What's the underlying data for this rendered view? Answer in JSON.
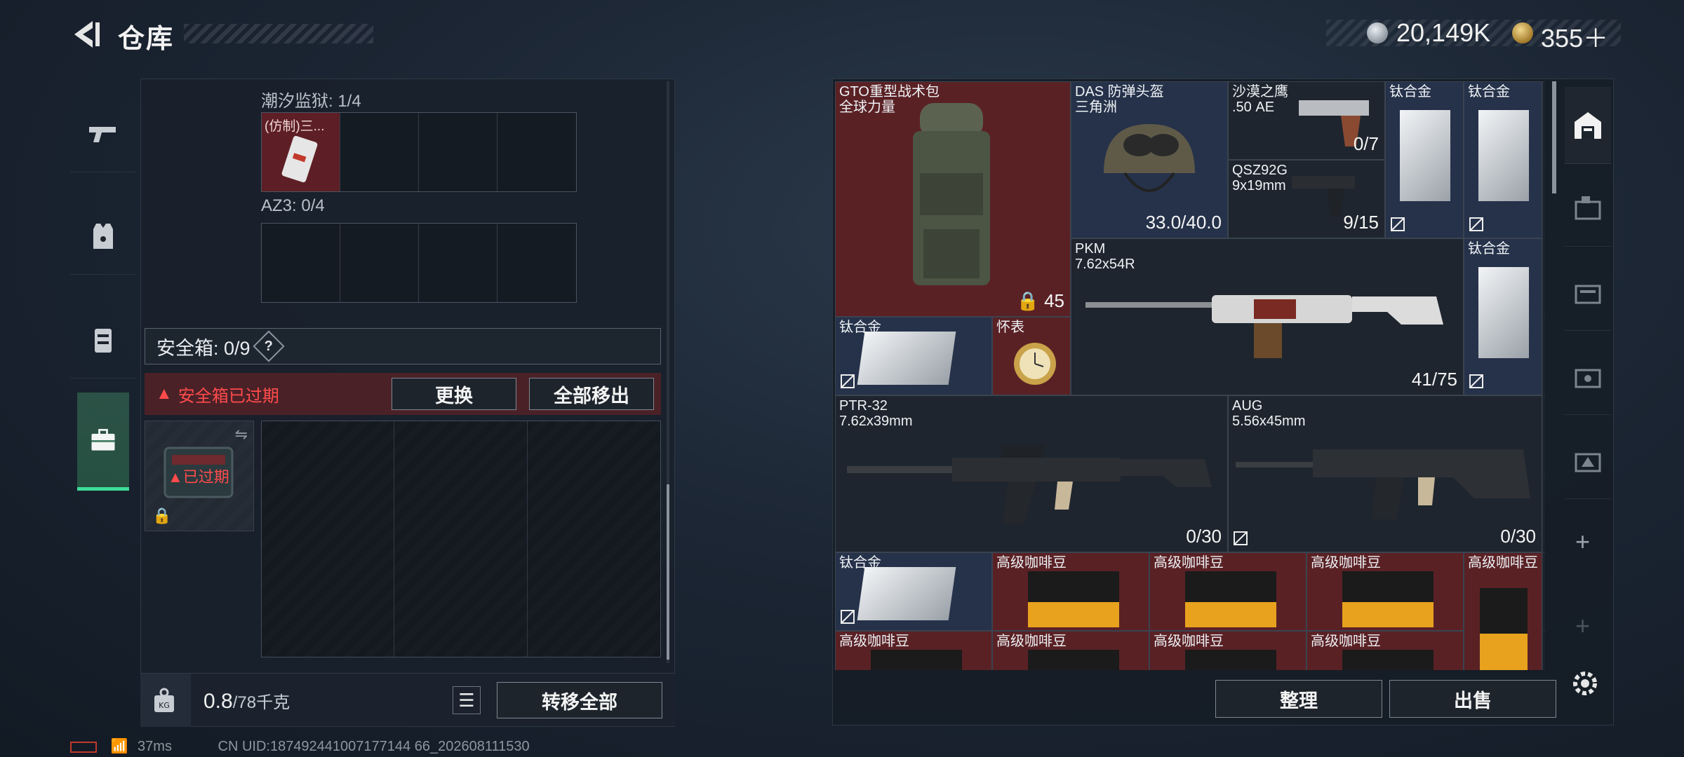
{
  "header": {
    "title": "仓库",
    "currency": [
      {
        "icon": "silver-coin-icon",
        "value": "20,149K"
      },
      {
        "icon": "gold-coin-icon",
        "value": "355＋"
      }
    ]
  },
  "left_nav": [
    "weapons-icon",
    "armor-icon",
    "backpack-icon",
    "safebox-icon"
  ],
  "left_panel": {
    "container1": {
      "label": "潮汐监狱: 1/4",
      "item": "(仿制)三..."
    },
    "container2": {
      "label": "AZ3: 0/4"
    },
    "safe_header": "安全箱: 0/9",
    "help": "?",
    "expired_warning": "安全箱已过期",
    "replace_btn": "更换",
    "move_all_out_btn": "全部移出",
    "case_status": "已过期",
    "weight_value": "0.8",
    "weight_max": "/78千克",
    "transfer_all_btn": "转移全部"
  },
  "inventory": {
    "backpack": {
      "name": "GTO重型战术包\n全球力量",
      "count": "45"
    },
    "helmet": {
      "name": "DAS 防弹头盔\n三角洲",
      "count": "33.0/40.0"
    },
    "deagle": {
      "name": "沙漠之鹰\n.50 AE",
      "count": "0/7"
    },
    "qsz": {
      "name": "QSZ92G\n9x19mm",
      "count": "9/15"
    },
    "titanium": "钛合金",
    "pkm": {
      "name": "PKM\n7.62x54R",
      "count": "41/75"
    },
    "watch": "怀表",
    "ptr": {
      "name": "PTR-32\n7.62x39mm",
      "count": "0/30"
    },
    "aug": {
      "name": "AUG\n5.56x45mm",
      "count": "0/30"
    },
    "coffee": "高级咖啡豆"
  },
  "right_footer": {
    "sort_btn": "整理",
    "sell_btn": "出售"
  },
  "status": {
    "ping": "37ms",
    "uid": "CN UID:187492441007177144 66_202608111530"
  },
  "colors": {
    "red_cell": "#5a2125",
    "navy_cell": "#26324a",
    "accent_green": "#3ddc97",
    "warning_red": "#ff4b4b"
  }
}
